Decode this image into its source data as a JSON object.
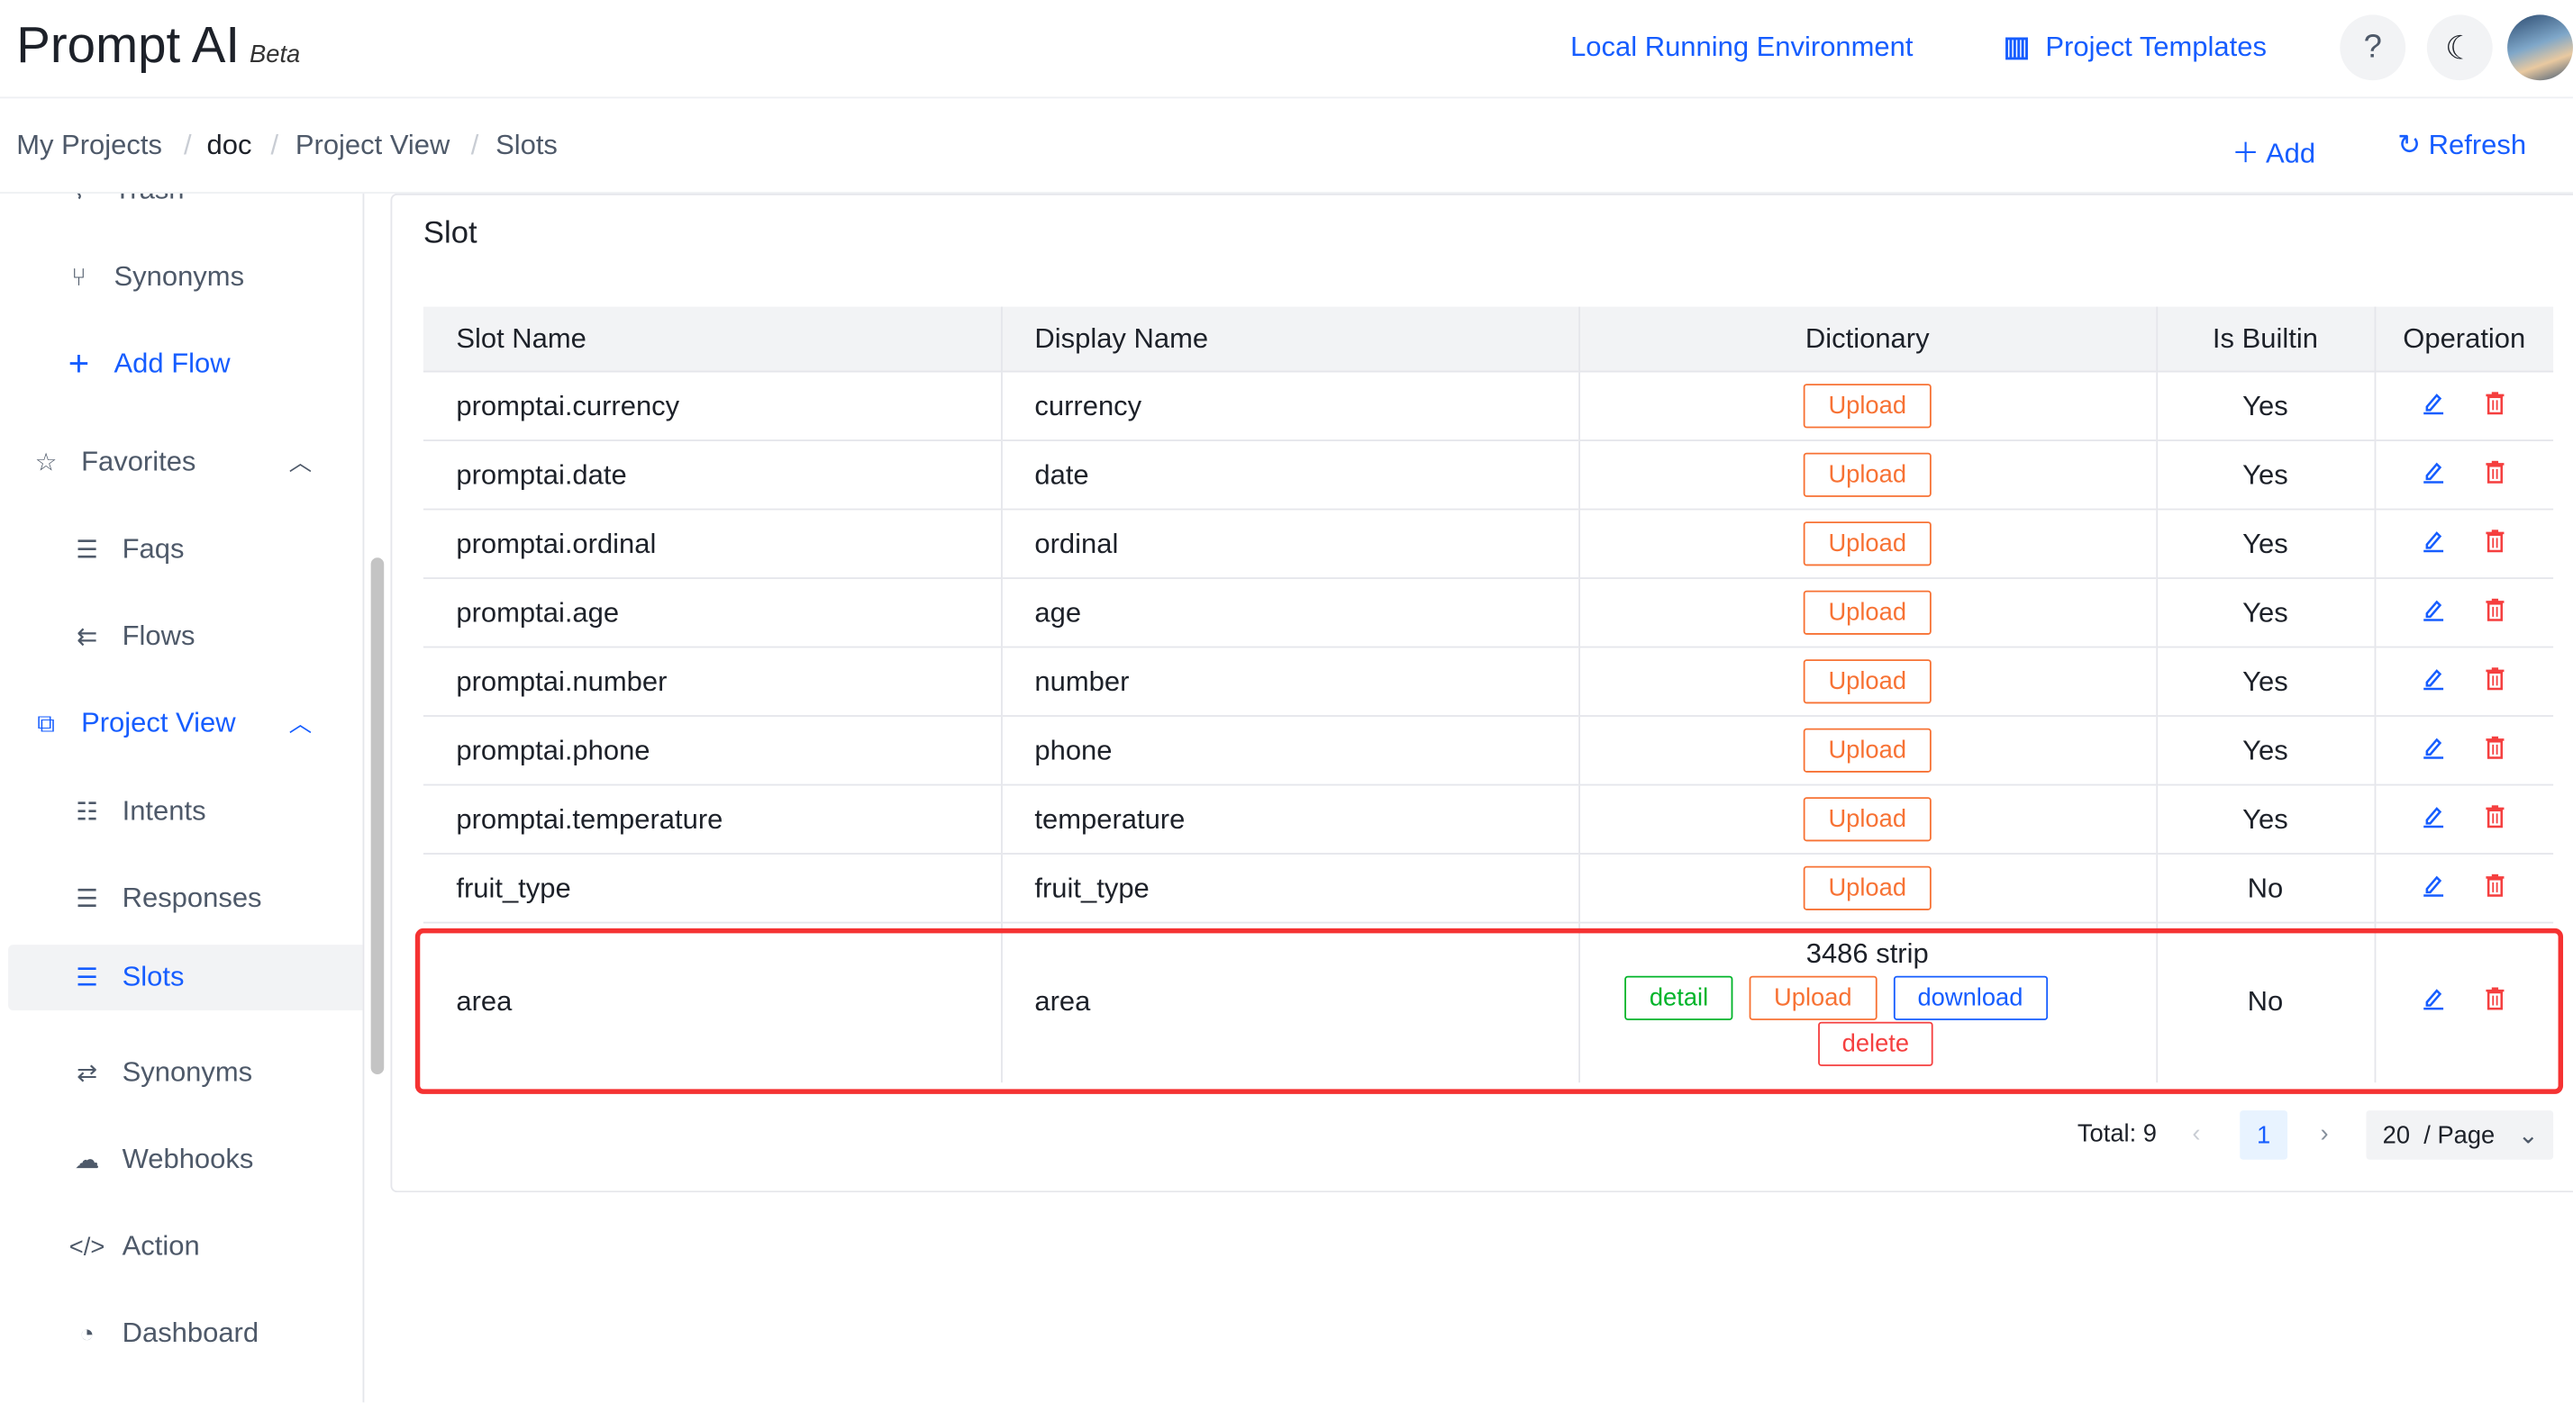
{
  "header": {
    "app_title": "Prompt AI",
    "beta": "Beta",
    "local_env": "Local Running Environment",
    "templates": "Project Templates",
    "help_icon": "?",
    "theme_icon": "moon"
  },
  "breadcrumb": [
    "My Projects",
    "doc",
    "Project View",
    "Slots"
  ],
  "actions": {
    "add": "Add",
    "refresh": "Refresh"
  },
  "sidebar": {
    "trash": "Trash",
    "synonyms_top": "Synonyms",
    "add_flow": "Add Flow",
    "favorites": "Favorites",
    "faqs": "Faqs",
    "flows": "Flows",
    "project_view": "Project View",
    "intents": "Intents",
    "responses": "Responses",
    "slots": "Slots",
    "synonyms": "Synonyms",
    "webhooks": "Webhooks",
    "action": "Action",
    "dashboard": "Dashboard"
  },
  "main": {
    "title": "Slot",
    "columns": [
      "Slot Name",
      "Display Name",
      "Dictionary",
      "Is Builtin",
      "Operation"
    ],
    "upload_label": "Upload",
    "rows": [
      {
        "slot": "promptai.currency",
        "display": "currency",
        "builtin": "Yes"
      },
      {
        "slot": "promptai.date",
        "display": "date",
        "builtin": "Yes"
      },
      {
        "slot": "promptai.ordinal",
        "display": "ordinal",
        "builtin": "Yes"
      },
      {
        "slot": "promptai.age",
        "display": "age",
        "builtin": "Yes"
      },
      {
        "slot": "promptai.number",
        "display": "number",
        "builtin": "Yes"
      },
      {
        "slot": "promptai.phone",
        "display": "phone",
        "builtin": "Yes"
      },
      {
        "slot": "promptai.temperature",
        "display": "temperature",
        "builtin": "Yes"
      },
      {
        "slot": "fruit_type",
        "display": "fruit_type",
        "builtin": "No"
      }
    ],
    "last_row": {
      "slot": "area",
      "display": "area",
      "count": "3486 strip",
      "detail": "detail",
      "upload": "Upload",
      "download": "download",
      "delete": "delete",
      "builtin": "No"
    }
  },
  "pagination": {
    "total": "Total: 9",
    "page": "1",
    "page_size": "20",
    "per_page": "/ Page"
  },
  "colors": {
    "accent": "#165dff",
    "upload": "#f77234",
    "detail": "#00b42a",
    "danger": "#f53f3f",
    "highlight": "#f53232"
  }
}
